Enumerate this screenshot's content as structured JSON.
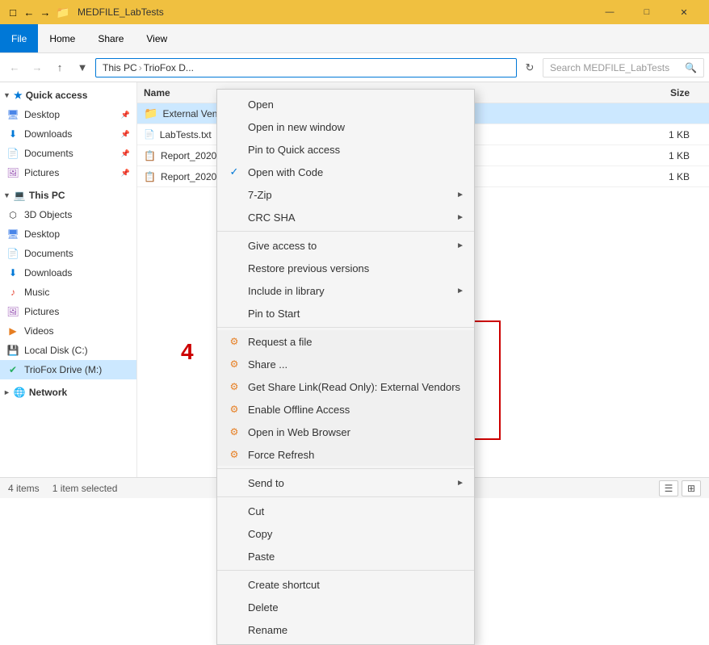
{
  "titleBar": {
    "title": "MEDFILE_LabTests",
    "minimize": "—",
    "maximize": "□",
    "close": "✕"
  },
  "ribbon": {
    "tabs": [
      "File",
      "Home",
      "Share",
      "View"
    ]
  },
  "addressBar": {
    "path": [
      "This PC",
      "TrioFox D..."
    ],
    "searchPlaceholder": "Search MEDFILE_LabTests"
  },
  "sidebar": {
    "quickAccess": "Quick access",
    "items": [
      {
        "label": "Desktop",
        "pinned": true
      },
      {
        "label": "Downloads",
        "pinned": true
      },
      {
        "label": "Documents",
        "pinned": true
      },
      {
        "label": "Pictures",
        "pinned": true
      }
    ],
    "thisPC": "This PC",
    "thisPCItems": [
      {
        "label": "3D Objects"
      },
      {
        "label": "Desktop"
      },
      {
        "label": "Documents"
      },
      {
        "label": "Downloads"
      },
      {
        "label": "Music"
      },
      {
        "label": "Pictures"
      },
      {
        "label": "Videos"
      },
      {
        "label": "Local Disk (C:)"
      },
      {
        "label": "TrioFox Drive (M:)",
        "selected": true
      }
    ],
    "network": "Network"
  },
  "fileList": {
    "columns": [
      "Name",
      "Size"
    ],
    "files": [
      {
        "name": "External Vendors",
        "type": "folder",
        "size": "",
        "selected": true
      },
      {
        "name": "LabTests.txt",
        "type": "txt",
        "size": "1 KB"
      },
      {
        "name": "Report_2020...",
        "type": "doc",
        "size": "1 KB"
      },
      {
        "name": "Report_2020...",
        "type": "doc",
        "size": "1 KB"
      }
    ]
  },
  "contextMenu": {
    "items": [
      {
        "label": "Open",
        "type": "item"
      },
      {
        "label": "Open in new window",
        "type": "item"
      },
      {
        "label": "Pin to Quick access",
        "type": "item"
      },
      {
        "label": "Open with Code",
        "type": "item",
        "checked": true
      },
      {
        "label": "7-Zip",
        "type": "submenu"
      },
      {
        "label": "CRC SHA",
        "type": "submenu"
      },
      {
        "sep": true
      },
      {
        "label": "Give access to",
        "type": "submenu"
      },
      {
        "label": "Restore previous versions",
        "type": "item"
      },
      {
        "label": "Include in library",
        "type": "submenu"
      },
      {
        "label": "Pin to Start",
        "type": "item"
      },
      {
        "sep": true
      },
      {
        "label": "Request a file",
        "type": "share",
        "icon": "share"
      },
      {
        "label": "Share ...",
        "type": "share",
        "icon": "share"
      },
      {
        "label": "Get Share Link(Read Only): External Vendors",
        "type": "share",
        "icon": "share"
      },
      {
        "label": "Enable Offline Access",
        "type": "share",
        "icon": "share"
      },
      {
        "label": "Open in Web Browser",
        "type": "share",
        "icon": "share"
      },
      {
        "label": "Force Refresh",
        "type": "share",
        "icon": "share"
      },
      {
        "sep2": true
      },
      {
        "label": "Send to",
        "type": "submenu"
      },
      {
        "sep": true
      },
      {
        "label": "Cut",
        "type": "item"
      },
      {
        "label": "Copy",
        "type": "item"
      },
      {
        "label": "Paste",
        "type": "item"
      },
      {
        "sep": true
      },
      {
        "label": "Create shortcut",
        "type": "item"
      },
      {
        "label": "Delete",
        "type": "item"
      },
      {
        "label": "Rename",
        "type": "item"
      }
    ]
  },
  "statusBar": {
    "count": "4 items",
    "selected": "1 item selected"
  },
  "highlightBox": {
    "number": "4"
  }
}
